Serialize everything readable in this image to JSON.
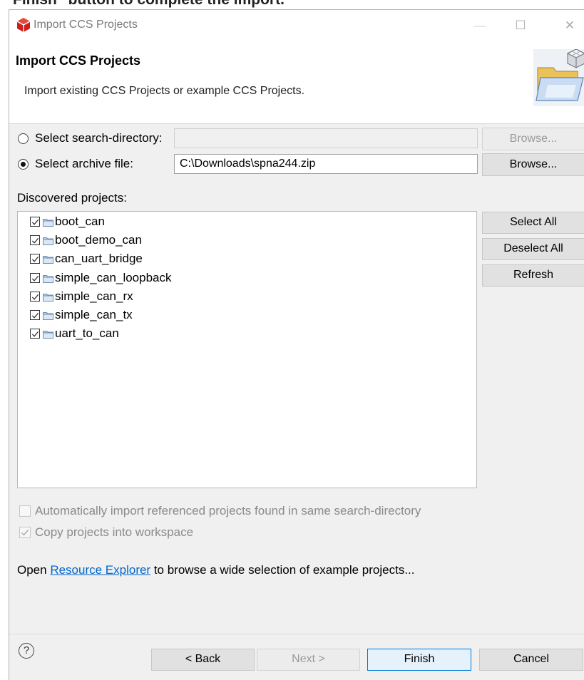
{
  "top_partial_text": "Finish\" button to complete the import.",
  "window": {
    "title": "Import CCS Projects",
    "minimize": "—",
    "maximize": "☐",
    "close": "✕"
  },
  "banner": {
    "title": "Import CCS Projects",
    "description": "Import existing CCS Projects or example CCS Projects.",
    "icon": "folder-cube-wizard-icon"
  },
  "source": {
    "search_dir_label": "Select search-directory:",
    "search_dir_value": "",
    "search_dir_selected": false,
    "archive_label": "Select archive file:",
    "archive_value": "C:\\Downloads\\spna244.zip",
    "archive_selected": true,
    "browse_label": "Browse...",
    "browse_archive_label": "Browse..."
  },
  "projects": {
    "label": "Discovered projects:",
    "items": [
      {
        "name": "boot_can",
        "checked": true
      },
      {
        "name": "boot_demo_can",
        "checked": true
      },
      {
        "name": "can_uart_bridge",
        "checked": true
      },
      {
        "name": "simple_can_loopback",
        "checked": true
      },
      {
        "name": "simple_can_rx",
        "checked": true
      },
      {
        "name": "simple_can_tx",
        "checked": true
      },
      {
        "name": "uart_to_can",
        "checked": true
      }
    ],
    "select_all": "Select All",
    "deselect_all": "Deselect All",
    "refresh": "Refresh"
  },
  "options": {
    "auto_import_label": "Automatically import referenced projects found in same search-directory",
    "auto_import_checked": false,
    "copy_label": "Copy projects into workspace",
    "copy_checked": true
  },
  "resource": {
    "prefix": "Open ",
    "link": "Resource Explorer",
    "suffix": " to browse a wide selection of example projects..."
  },
  "footer": {
    "help_glyph": "?",
    "back": "< Back",
    "next": "Next >",
    "finish": "Finish",
    "cancel": "Cancel"
  },
  "colors": {
    "dialog_bg": "#f0f0f0",
    "link": "#0066cc",
    "default_button_border": "#0078d7",
    "app_icon": "#cc1f1f"
  }
}
